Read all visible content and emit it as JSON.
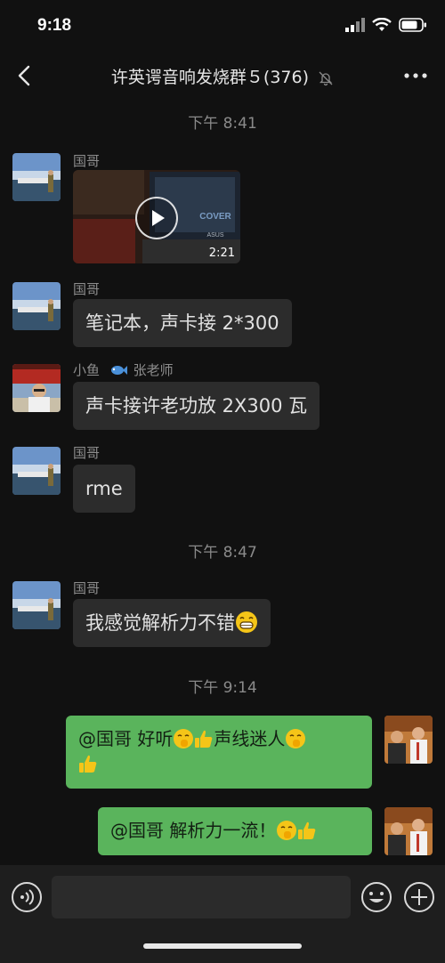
{
  "status": {
    "time": "9:18"
  },
  "nav": {
    "title": "许英谔音响发烧群５(376)"
  },
  "timestamps": [
    "下午 8:41",
    "下午 8:47",
    "下午 9:14"
  ],
  "messages": [
    {
      "sender": "国哥",
      "type": "video",
      "duration": "2:21",
      "overlay_text": "COVER",
      "overlay_brand": "ASUS"
    },
    {
      "sender": "国哥",
      "text": "笔记本，声卡接 2*300"
    },
    {
      "sender_prefix": "小鱼",
      "sender_suffix": "张老师",
      "text": "声卡接许老功放 2X300 瓦"
    },
    {
      "sender": "国哥",
      "text": "rme"
    },
    {
      "sender": "国哥",
      "text": "我感觉解析力不错"
    },
    {
      "out": true,
      "seg1": "@国哥 好听",
      "seg2": "声线迷人"
    },
    {
      "out": true,
      "seg1": "@国哥 解析力一流！"
    }
  ],
  "icons": [
    "back-icon",
    "mute-bell-icon",
    "more-icon",
    "voice-icon",
    "emoji-icon",
    "plus-icon",
    "play-icon"
  ],
  "colors": {
    "background": "#111111",
    "incoming_bubble": "#2c2c2c",
    "outgoing_bubble": "#5ab45c",
    "text_muted": "#8a8a8a"
  }
}
